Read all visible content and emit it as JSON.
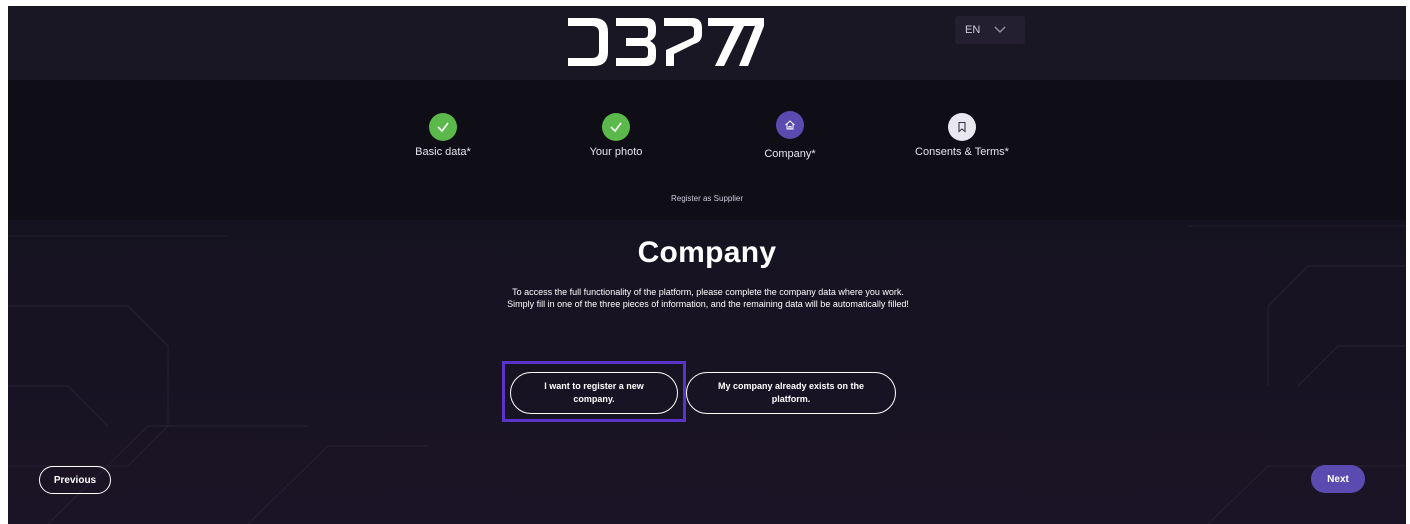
{
  "header": {
    "logo_text": "DBR77",
    "language": {
      "selected": "EN"
    }
  },
  "stepper": {
    "steps": [
      {
        "label": "Basic data*",
        "status": "completed",
        "icon": "check-icon"
      },
      {
        "label": "Your photo",
        "status": "completed",
        "icon": "check-icon"
      },
      {
        "label": "Company*",
        "status": "active",
        "icon": "home-icon"
      },
      {
        "label": "Consents & Terms*",
        "status": "pending",
        "icon": "bookmark-icon"
      }
    ],
    "subtitle": "Register as Supplier"
  },
  "main": {
    "title": "Company",
    "description": "To access the full functionality of the platform, please complete the company data where you work. Simply fill in one of the three pieces of information, and the remaining data will be automatically filled!",
    "options": [
      {
        "label": "I want to register a new company.",
        "selected": true
      },
      {
        "label": "My company already exists on the platform.",
        "selected": false
      }
    ]
  },
  "footer": {
    "previous_label": "Previous",
    "next_label": "Next"
  },
  "colors": {
    "background": "#15121f",
    "accent": "#5b4bb0",
    "success": "#5bb84a",
    "highlight": "#5a34c8"
  }
}
